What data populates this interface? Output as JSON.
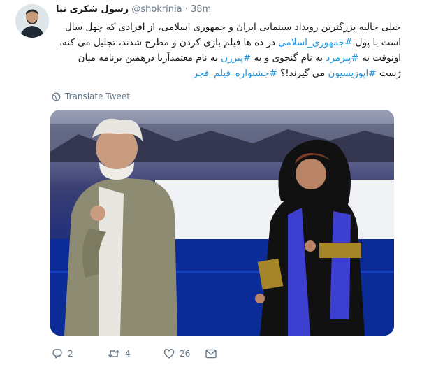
{
  "tweet": {
    "author_name": "رسول شکری نیا",
    "handle": "@shokrinia",
    "separator": "·",
    "timestamp": "38m",
    "text_parts": [
      {
        "text": "خیلی جالبه بزرگترین رویداد سینمایی ایران و جمهوری اسلامی، از افرادی که چهل سال است با پول ",
        "link": false
      },
      {
        "text": "#جمهوری_اسلامی",
        "link": true
      },
      {
        "text": " در ده ها فیلم بازی کردن و مطرح شدند، تجلیل می کنه، اونوقت به ",
        "link": false
      },
      {
        "text": "#پیرمرد",
        "link": true
      },
      {
        "text": " به نام گنجوی و به ",
        "link": false
      },
      {
        "text": "#پیرزن",
        "link": true
      },
      {
        "text": " به نام معتمدآریا درهمین برنامه میان ژست ",
        "link": false
      },
      {
        "text": "#اپوزیسیون",
        "link": true
      },
      {
        "text": " می گیرند!؟ ",
        "link": false
      },
      {
        "text": "#جشنواره_فیلم_فجر",
        "link": true
      }
    ],
    "translate_label": "Translate Tweet",
    "translate_icon": "globe-icon",
    "media_alt": "",
    "actions": {
      "reply": {
        "icon": "reply-icon",
        "count": "2"
      },
      "retweet": {
        "icon": "retweet-icon",
        "count": "4"
      },
      "like": {
        "icon": "heart-icon",
        "count": "26"
      },
      "dm": {
        "icon": "envelope-icon"
      }
    },
    "colors": {
      "link": "#1b95e0",
      "muted": "#657786",
      "text": "#14171a"
    }
  }
}
